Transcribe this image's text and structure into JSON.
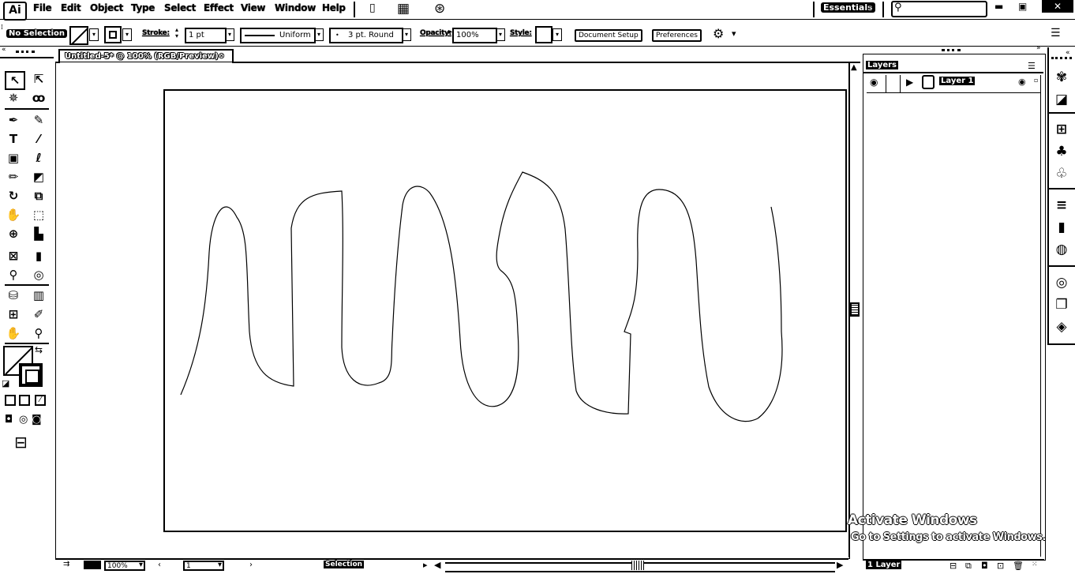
{
  "app": {
    "logo": "Ai"
  },
  "menu": [
    "File",
    "Edit",
    "Object",
    "Type",
    "Select",
    "Effect",
    "View",
    "Window",
    "Help"
  ],
  "workspace": {
    "label": "Essentials"
  },
  "search": {
    "placeholder": ""
  },
  "control": {
    "selection_label": "No Selection",
    "stroke_label": "Stroke:",
    "stroke_weight": "1 pt",
    "profile": "Uniform",
    "brush": "3 pt. Round",
    "opacity_label": "Opacity:",
    "opacity_value": "100%",
    "style_label": "Style:",
    "doc_setup": "Document Setup",
    "preferences": "Preferences"
  },
  "document": {
    "tab_title": "Untitled-5* @ 100% (RGB/Preview)"
  },
  "layers_panel": {
    "tab": "Layers",
    "layer_name": "Layer 1",
    "footer_count": "1 Layer"
  },
  "status": {
    "zoom": "100%",
    "page": "1",
    "tool": "Selection"
  },
  "watermark": {
    "line1": "Activate Windows",
    "line2": "Go to Settings to activate Windows."
  },
  "icons": {
    "tools": [
      "selection-tool-icon",
      "direct-selection-tool-icon",
      "magic-wand-icon",
      "lasso-icon",
      "pen-tool-icon",
      "curvature-icon",
      "type-tool-icon",
      "line-tool-icon",
      "rectangle-tool-icon",
      "paintbrush-icon",
      "pencil-icon",
      "eraser-icon",
      "rotate-icon",
      "scale-icon",
      "warp-icon",
      "free-transform-icon",
      "shape-builder-icon",
      "perspective-grid-icon",
      "mesh-icon",
      "gradient-icon",
      "eyedropper-icon",
      "blend-icon",
      "symbol-sprayer-icon",
      "column-graph-icon",
      "artboard-icon",
      "slice-icon",
      "hand-icon",
      "zoom-icon"
    ],
    "dock": [
      "color-icon",
      "color-guide-icon",
      "swatches-icon",
      "brushes-icon",
      "symbols-icon",
      "stroke-icon",
      "gradient-panel-icon",
      "transparency-icon",
      "appearance-icon",
      "graphic-styles-icon",
      "layers-dock-icon"
    ]
  }
}
